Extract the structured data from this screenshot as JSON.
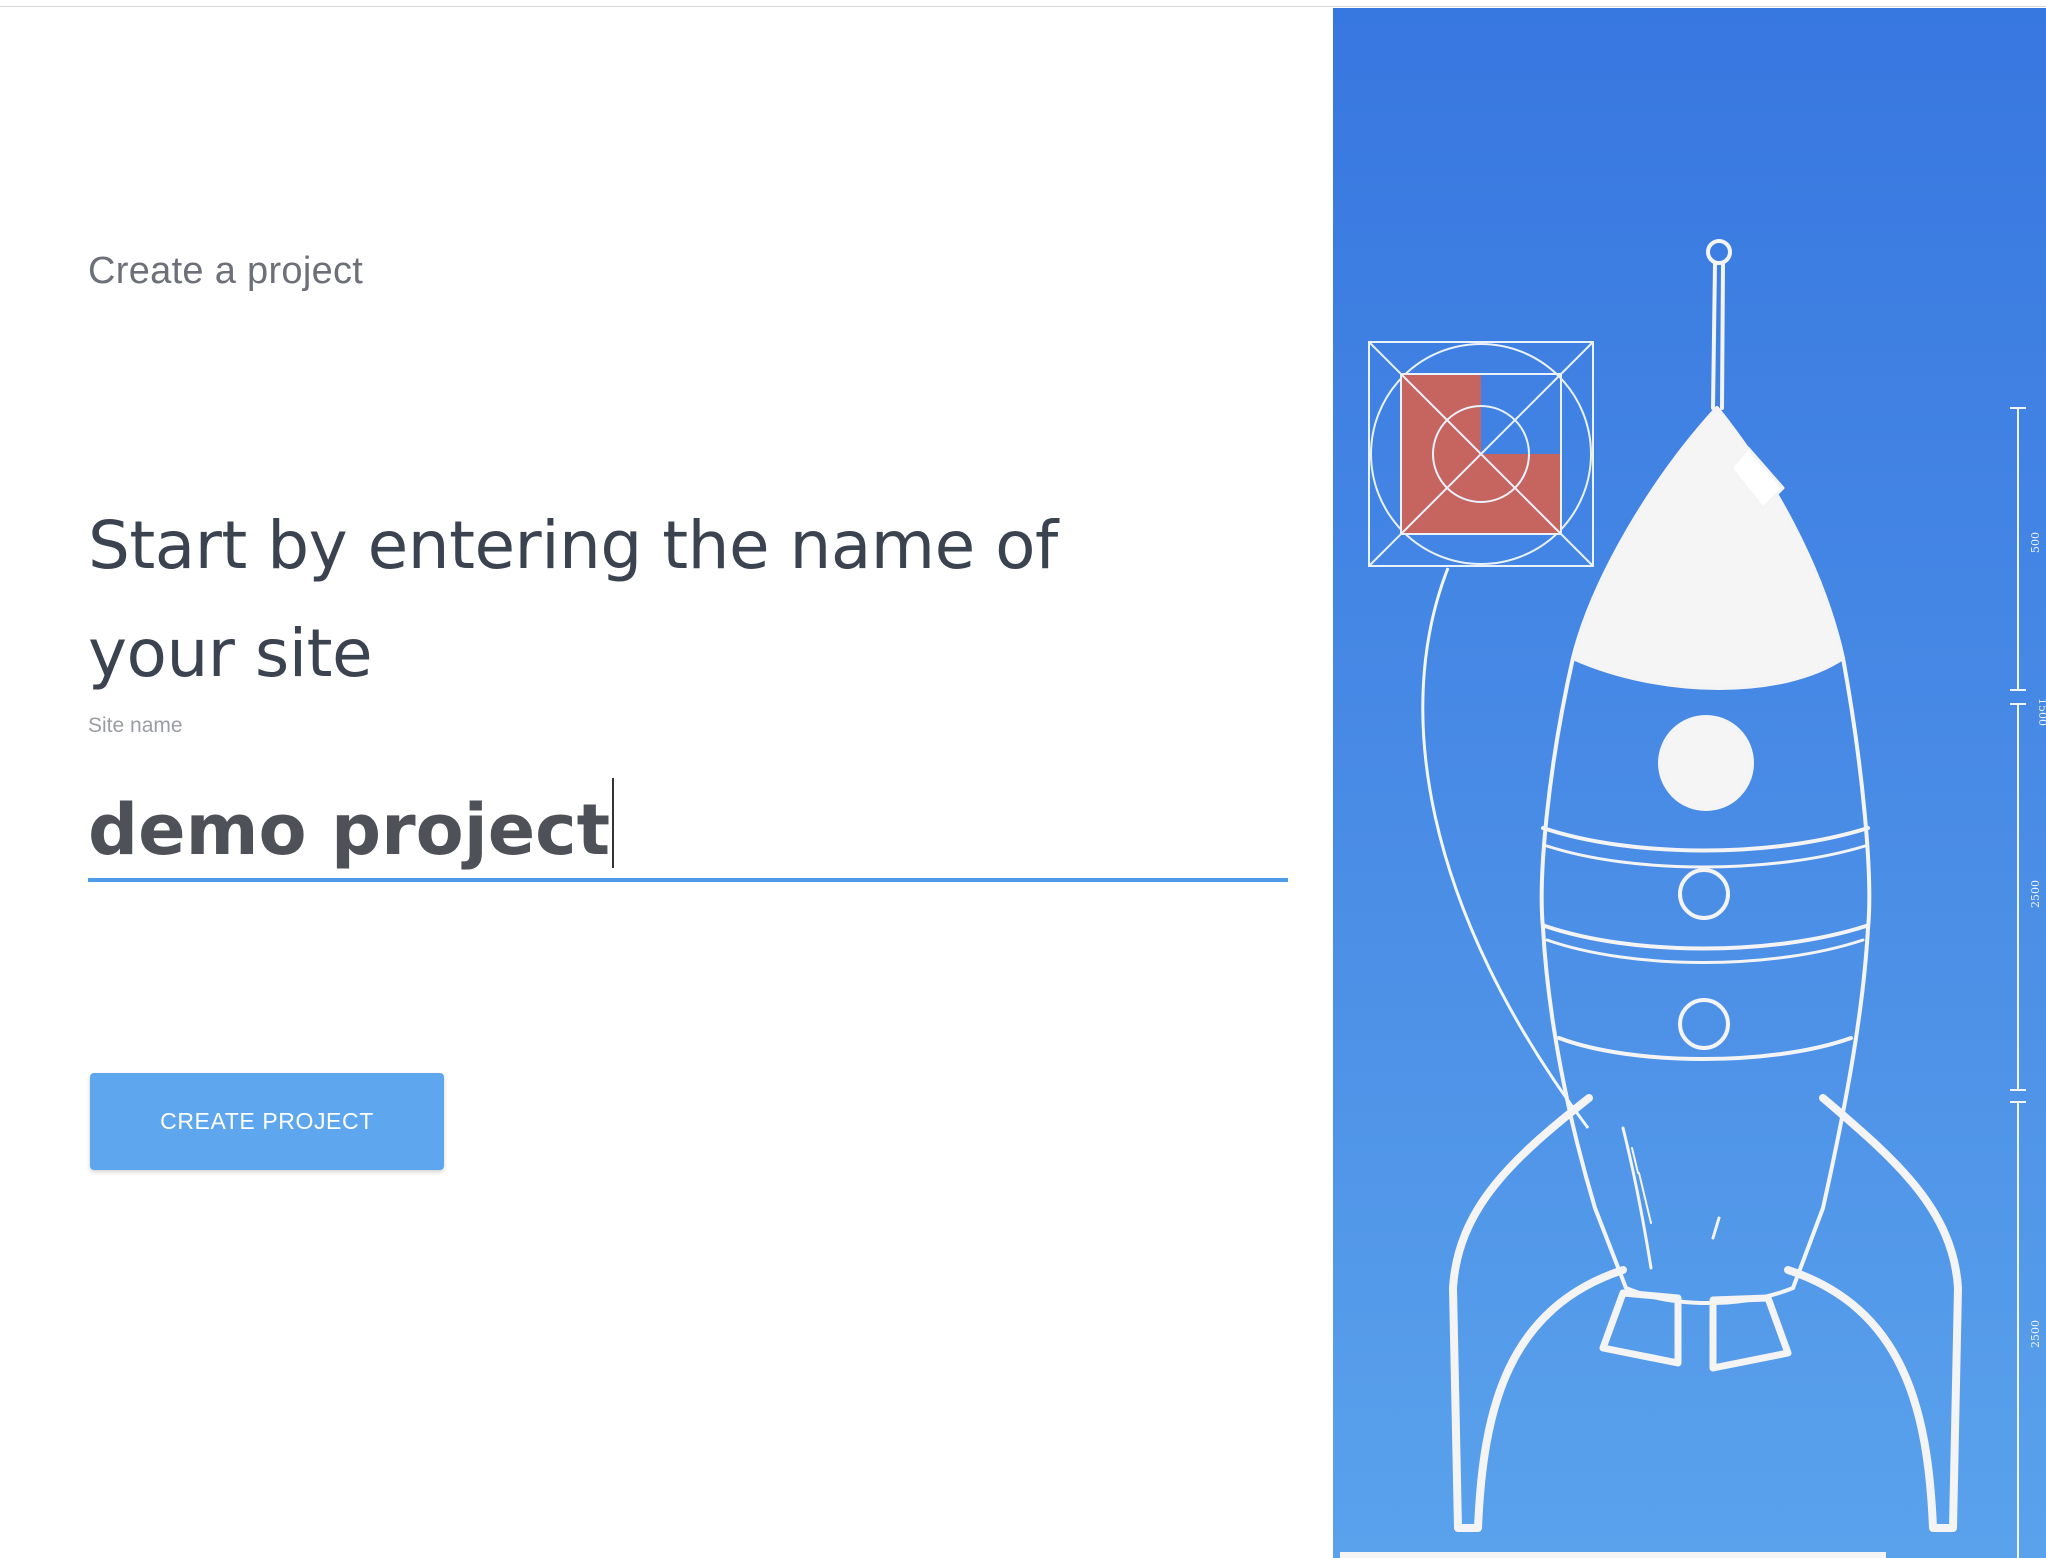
{
  "page": {
    "eyebrow": "Create a project",
    "headline": "Start by entering the name of your site"
  },
  "site_name_field": {
    "label": "Site name",
    "value": "demo project"
  },
  "actions": {
    "create_label": "CREATE PROJECT"
  },
  "illustration": {
    "name": "rocket-blueprint",
    "dimension_labels": [
      "500",
      "1500",
      "2500",
      "2500"
    ]
  },
  "colors": {
    "accent": "#4d9ae9",
    "button": "#5ea6ee",
    "panel_top": "#3777e0",
    "panel_bottom": "#5aa2ec",
    "logo_red": "#c66560"
  }
}
